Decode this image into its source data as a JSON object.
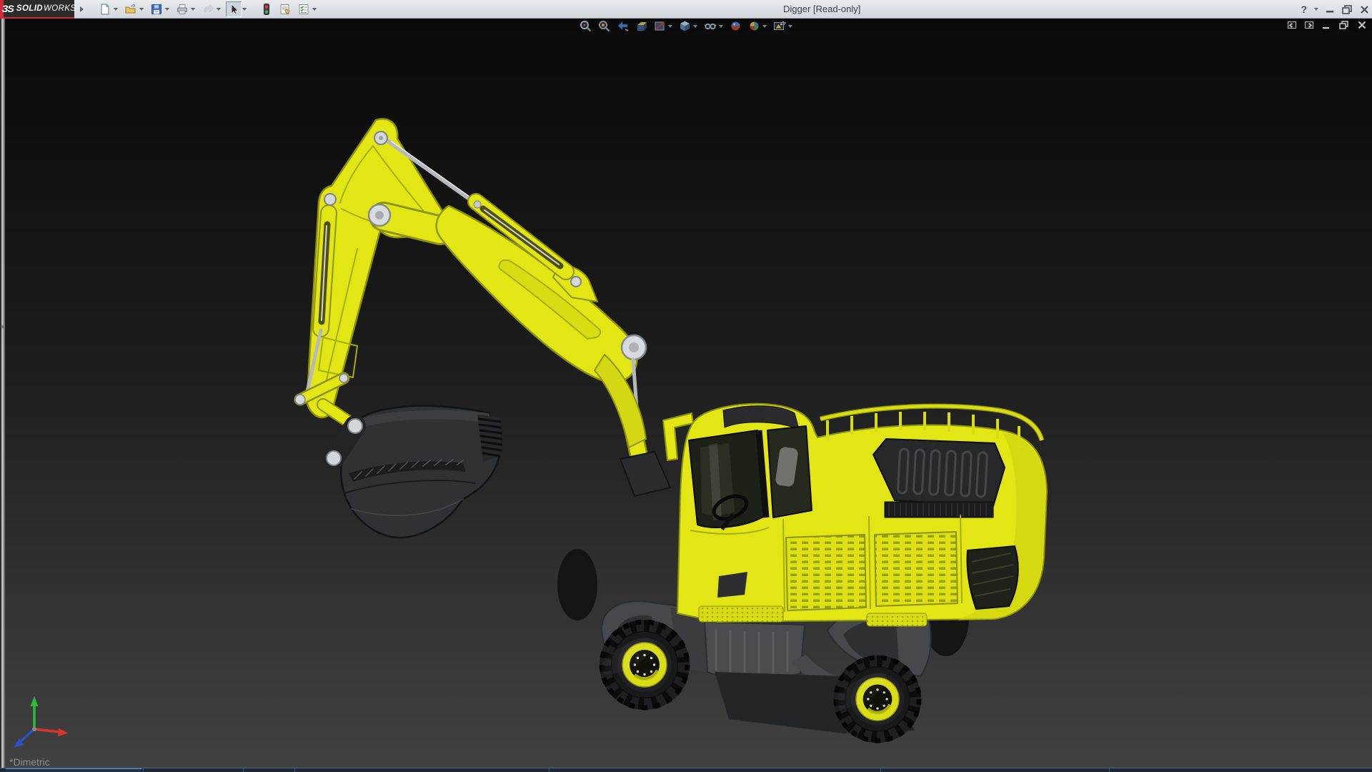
{
  "title_bar": {
    "brand": {
      "glyph": "ЗS",
      "name_bold": "SOLID",
      "name_light": "WORKS"
    },
    "document_title": "Digger [Read-only]",
    "toolbar_items": [
      {
        "id": "new",
        "icon": "new-document-icon",
        "dropdown": true
      },
      {
        "id": "open",
        "icon": "open-folder-icon",
        "dropdown": true
      },
      {
        "id": "save",
        "icon": "save-icon",
        "dropdown": true
      },
      {
        "id": "print",
        "icon": "print-icon",
        "dropdown": true
      },
      {
        "id": "undo",
        "icon": "undo-icon",
        "dropdown": true,
        "disabled": true
      },
      {
        "id": "select",
        "icon": "select-cursor-icon",
        "dropdown": true,
        "active": true
      },
      {
        "id": "rebuild",
        "icon": "rebuild-traffic-light-icon",
        "dropdown": false
      },
      {
        "id": "file-properties",
        "icon": "file-properties-icon",
        "dropdown": false
      },
      {
        "id": "options",
        "icon": "options-checklist-icon",
        "dropdown": true
      }
    ],
    "window_controls": {
      "help_glyph": "?",
      "buttons": [
        "help",
        "minimize",
        "restore",
        "close"
      ]
    }
  },
  "viewport": {
    "headsup_toolbar": [
      {
        "id": "zoom-to-fit",
        "dropdown": false
      },
      {
        "id": "zoom-to-area",
        "dropdown": false
      },
      {
        "id": "previous-view",
        "dropdown": false
      },
      {
        "id": "section-view",
        "dropdown": false
      },
      {
        "id": "display-style",
        "dropdown": true
      },
      {
        "id": "view-orientation",
        "dropdown": true
      },
      {
        "id": "hide-show-items",
        "dropdown": true
      },
      {
        "id": "edit-appearance",
        "dropdown": false
      },
      {
        "id": "apply-scene",
        "dropdown": true
      },
      {
        "id": "view-settings",
        "dropdown": true
      }
    ],
    "document_controls": [
      "pane-toggle-left",
      "pane-toggle-right",
      "minimize",
      "restore",
      "close"
    ],
    "view_label": "*Dimetric",
    "triad": {
      "x_color": "#d8362a",
      "y_color": "#2ebd3a",
      "z_color": "#2a52c8"
    },
    "model": {
      "name": "Digger",
      "body_color": "#e2e614",
      "body_shade": "#c9cd10",
      "dark_parts": "#2a2c2e",
      "chassis_gray": "#46484b",
      "pin_silver": "#d3d6da",
      "tire_black": "#101113"
    }
  },
  "colors": {
    "titlebar_bg": "#dfe3e7",
    "brand_red": "#cf2a35",
    "viewport_top": "#0a0a0a",
    "viewport_bottom": "#414141",
    "os_strip_line": "#3f6c9c"
  }
}
